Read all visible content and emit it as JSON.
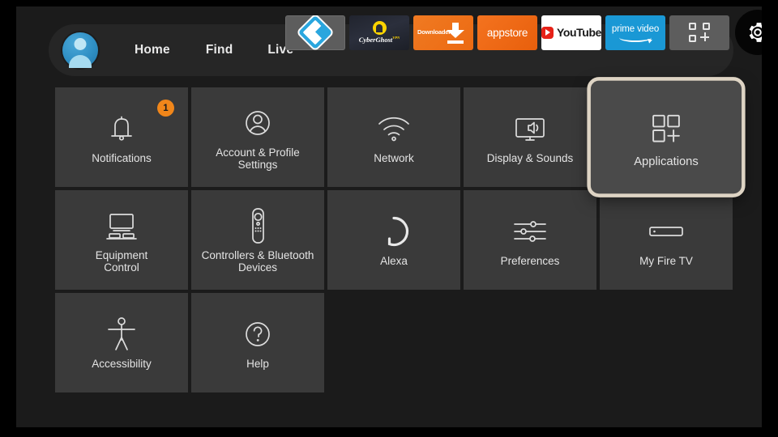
{
  "nav": {
    "avatar": "profile-avatar",
    "links": [
      {
        "label": "Home"
      },
      {
        "label": "Find"
      },
      {
        "label": "Live"
      }
    ],
    "apps": [
      {
        "name": "kodi",
        "label": ""
      },
      {
        "name": "cyberghost",
        "label": "CyberGhost",
        "sup": "VPN"
      },
      {
        "name": "downloader",
        "label": "Downloader"
      },
      {
        "name": "appstore",
        "label": "appstore"
      },
      {
        "name": "youtube",
        "label": "YouTube"
      },
      {
        "name": "prime-video",
        "label": "prime video"
      },
      {
        "name": "app-grid",
        "label": ""
      },
      {
        "name": "settings",
        "label": "",
        "badge": true
      }
    ]
  },
  "grid": {
    "tiles": [
      {
        "name": "notifications",
        "label": "Notifications",
        "icon": "bell-icon",
        "badge": "1"
      },
      {
        "name": "account-profile",
        "label": "Account & Profile\nSettings",
        "icon": "person-icon"
      },
      {
        "name": "network",
        "label": "Network",
        "icon": "wifi-icon"
      },
      {
        "name": "display-sounds",
        "label": "Display & Sounds",
        "icon": "tv-speaker-icon"
      },
      {
        "name": "applications",
        "label": "Applications",
        "icon": "app-grid-icon",
        "focused": true
      },
      {
        "name": "equipment-control",
        "label": "Equipment\nControl",
        "icon": "tv-equipment-icon"
      },
      {
        "name": "controllers-bluetooth",
        "label": "Controllers & Bluetooth\nDevices",
        "icon": "remote-icon"
      },
      {
        "name": "alexa",
        "label": "Alexa",
        "icon": "alexa-ring-icon"
      },
      {
        "name": "preferences",
        "label": "Preferences",
        "icon": "sliders-icon"
      },
      {
        "name": "my-fire-tv",
        "label": "My Fire TV",
        "icon": "firestick-icon"
      },
      {
        "name": "accessibility",
        "label": "Accessibility",
        "icon": "accessibility-icon"
      },
      {
        "name": "help",
        "label": "Help",
        "icon": "question-circle-icon"
      }
    ]
  },
  "colors": {
    "accent_orange": "#f0861a",
    "focus_border": "#ded4c4",
    "tile_bg": "#3a3a3a",
    "screen_bg": "#1b1b1b"
  }
}
